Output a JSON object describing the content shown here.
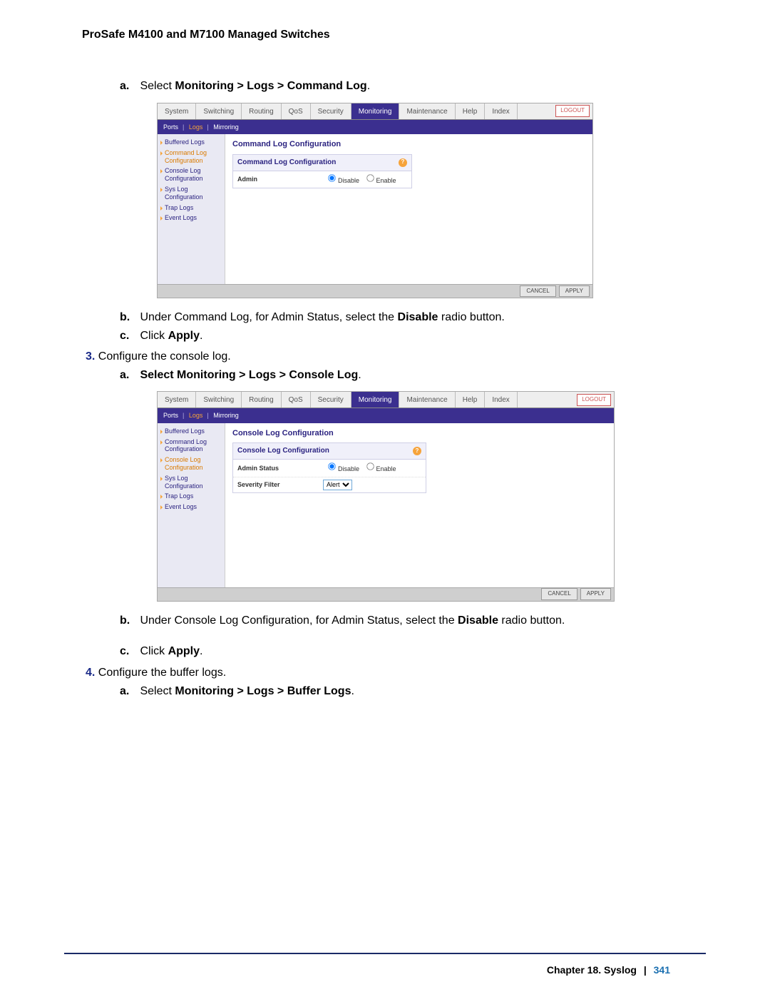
{
  "header": "ProSafe M4100 and M7100 Managed Switches",
  "steps": {
    "a1_prefix": "a.",
    "a1_text_pre": "Select ",
    "a1_text_bold": "Monitoring > Logs > Command Log",
    "b1_prefix": "b.",
    "b1_text_pre": "Under Command Log, for Admin Status, select the ",
    "b1_bold": "Disable",
    "b1_post": " radio button.",
    "c1_prefix": "c.",
    "c1_text_pre": "Click ",
    "c1_bold": "Apply",
    "n3_prefix": "3.",
    "n3_text": "Configure the console log.",
    "a2_prefix": "a.",
    "a2_bold": "Select Monitoring > Logs > Console Log",
    "b2_prefix": "b.",
    "b2_text_pre": "Under Console Log Configuration, for Admin Status",
    "b2_mid": ", select the ",
    "b2_bold": "Disable",
    "b2_post": " radio button.",
    "c2_prefix": "c.",
    "c2_text_pre": "Click ",
    "c2_bold": "Apply",
    "n4_prefix": "4.",
    "n4_text": "Configure the buffer logs.",
    "a3_prefix": "a.",
    "a3_text_pre": "Select ",
    "a3_bold": "Monitoring > Logs > Buffer Logs"
  },
  "tabs": [
    "System",
    "Switching",
    "Routing",
    "QoS",
    "Security",
    "Monitoring",
    "Maintenance",
    "Help",
    "Index"
  ],
  "logout": "LOGOUT",
  "subtabs": {
    "items": [
      "Ports",
      "Logs",
      "Mirroring"
    ],
    "selected": "Logs"
  },
  "sidebar": [
    "Buffered Logs",
    "Command Log Configuration",
    "Console Log Configuration",
    "Sys Log Configuration",
    "Trap Logs",
    "Event Logs"
  ],
  "shot1": {
    "title": "Command Log Configuration",
    "panel_title": "Command Log Configuration",
    "row_label": "Admin",
    "opt_disable": "Disable",
    "opt_enable": "Enable",
    "active_side": 1
  },
  "shot2": {
    "title": "Console Log Configuration",
    "panel_title": "Console Log Configuration",
    "row1_label": "Admin Status",
    "row2_label": "Severity Filter",
    "severity_value": "Alert",
    "opt_disable": "Disable",
    "opt_enable": "Enable",
    "active_side": 2
  },
  "buttons": {
    "cancel": "CANCEL",
    "apply": "APPLY"
  },
  "footer": {
    "chapter": "Chapter 18.  Syslog",
    "page": "341"
  }
}
